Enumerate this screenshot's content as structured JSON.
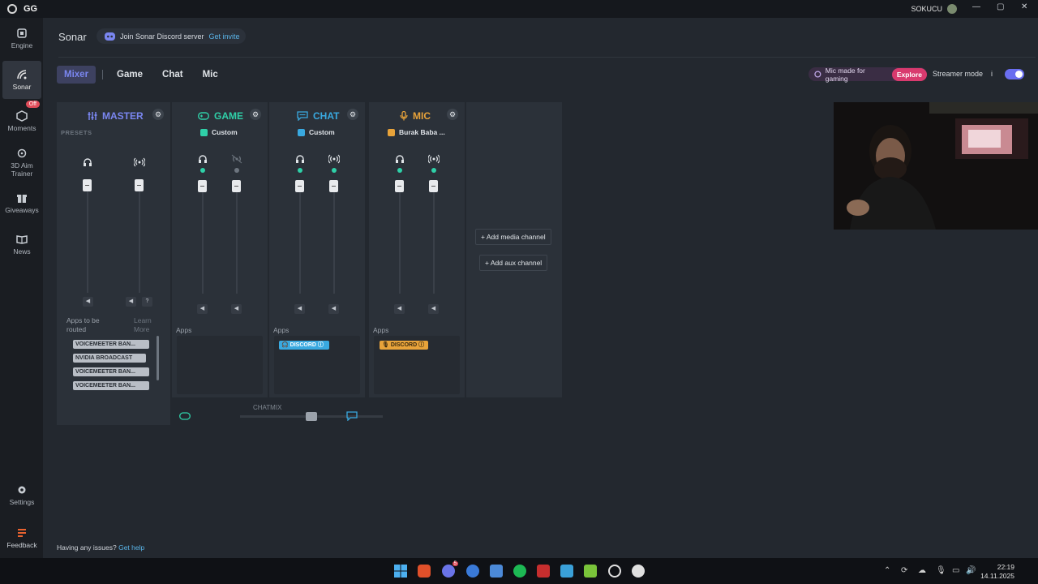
{
  "titlebar": {
    "app_name": "GG",
    "username": "SOKUCU",
    "minimize": "—",
    "maximize": "▢",
    "close": "✕"
  },
  "sidebar": {
    "items": [
      {
        "label": "Engine"
      },
      {
        "label": "Sonar"
      },
      {
        "label": "Moments",
        "badge": "Off"
      },
      {
        "label_line1": "3D Aim",
        "label_line2": "Trainer"
      },
      {
        "label": "Giveaways"
      },
      {
        "label": "News"
      },
      {
        "label": "Settings"
      },
      {
        "label": "Feedback"
      }
    ]
  },
  "header": {
    "title": "Sonar",
    "discord_text": "Join Sonar Discord server",
    "discord_link": "Get invite"
  },
  "tabs": [
    "Mixer",
    "Game",
    "Chat",
    "Mic"
  ],
  "promo": {
    "text": "Mic made for gaming",
    "button": "Explore"
  },
  "streamer_mode": {
    "label": "Streamer mode",
    "info": "i",
    "enabled": true
  },
  "channels": {
    "master": {
      "title": "MASTER",
      "sub": "PRESETS",
      "color": "#6f7ef0",
      "routed_label_1": "Apps to be",
      "routed_label_2": "routed",
      "learn_1": "Learn",
      "learn_2": "More",
      "routed_apps": [
        "VOICEMEETER BAN...",
        "NVIDIA BROADCAST",
        "VOICEMEETER BAN...",
        "VOICEMEETER BAN..."
      ]
    },
    "game": {
      "title": "GAME",
      "preset": "Custom",
      "color": "#2fd0a8",
      "apps_label": "Apps"
    },
    "chat": {
      "title": "CHAT",
      "preset": "Custom",
      "color": "#39a9e0",
      "apps_label": "Apps",
      "app": "DISCORD"
    },
    "mic": {
      "title": "MIC",
      "preset": "Burak Baba ...",
      "color": "#e8a33a",
      "apps_label": "Apps",
      "app": "DISCORD"
    }
  },
  "add_media": "+ Add media channel",
  "add_aux": "+ Add aux channel",
  "chatmix": {
    "label": "CHATMIX",
    "value": 0.5
  },
  "help": {
    "text": "Having any issues?",
    "link": "Get help"
  },
  "taskbar": {
    "time": "22:19",
    "date": "14.11.2025",
    "discord_badge": "5"
  }
}
